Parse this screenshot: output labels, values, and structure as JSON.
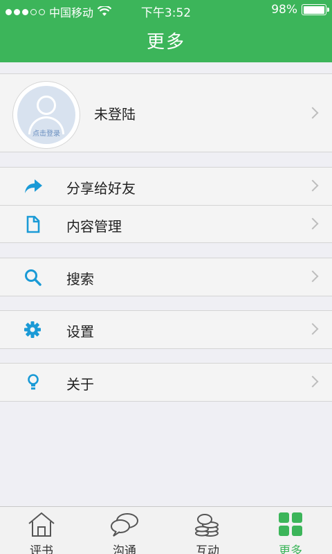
{
  "status_bar": {
    "carrier": "中国移动",
    "time": "下午3:52",
    "battery_text": "98%",
    "battery_level": 0.98,
    "signal_bars_filled": 3,
    "signal_bars_total": 5
  },
  "nav": {
    "title": "更多"
  },
  "profile": {
    "avatar_caption": "点击登录",
    "name": "未登陆"
  },
  "menu": [
    {
      "icon": "share-icon",
      "label": "分享给好友"
    },
    {
      "icon": "document-icon",
      "label": "内容管理"
    },
    {
      "icon": "search-icon",
      "label": "搜索"
    },
    {
      "icon": "gear-icon",
      "label": "设置"
    },
    {
      "icon": "lightbulb-icon",
      "label": "关于"
    }
  ],
  "tabs": [
    {
      "icon": "house-icon",
      "label": "评书"
    },
    {
      "icon": "chat-bubbles-icon",
      "label": "沟通"
    },
    {
      "icon": "coins-icon",
      "label": "互动"
    },
    {
      "icon": "grid-icon",
      "label": "更多",
      "active": true
    }
  ],
  "colors": {
    "brand_green": "#3cb55a",
    "icon_blue": "#1a9ad6",
    "background": "#efeff4"
  }
}
